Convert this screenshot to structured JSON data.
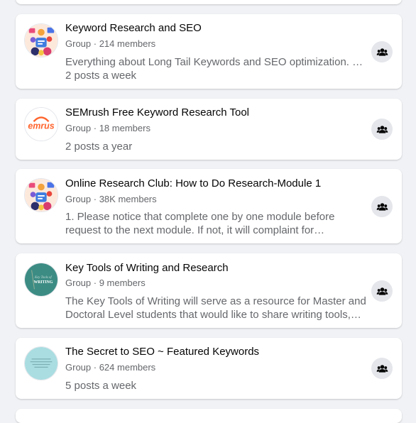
{
  "groups": [
    {
      "name": "Keyword Research and SEO",
      "type": "Group",
      "members": "214 members",
      "desc1": "Everything about Long Tail Keywords and SEO optimization. G…",
      "desc2": "2 posts a week",
      "avatar": "illustration-avatar"
    },
    {
      "name": "SEMrush Free Keyword Research Tool",
      "type": "Group",
      "members": "18 members",
      "desc1": "2 posts a year",
      "avatar": "semrush-logo",
      "avatar_text": "emrus"
    },
    {
      "name": "Online Research Club: How to Do Research-Module 1",
      "type": "Group",
      "members": "38K members",
      "desc1": "1. Please notice that complete one by one module before",
      "desc2": "request to the next module. If not, it will complaint for…",
      "avatar": "illustration-avatar"
    },
    {
      "name": "Key Tools of Writing and Research",
      "type": "Group",
      "members": "9 members",
      "desc1": "The Key Tools of Writing will serve as a resource for Master and",
      "desc2": "Doctoral Level students that would like to share writing tools,…",
      "avatar": "writing-avatar",
      "avatar_text": "WRITING"
    },
    {
      "name": "The Secret to SEO ~ Featured Keywords",
      "type": "Group",
      "members": "624 members",
      "desc1": "5 posts a week",
      "avatar": "light-blue-avatar"
    }
  ],
  "separator": " · ",
  "colors": {
    "page_bg": "#f0f2f5",
    "card_bg": "#ffffff",
    "title": "#050505",
    "secondary": "#65676b",
    "button_bg": "#e4e6eb",
    "semrush_orange": "#ff642d",
    "writing_teal": "#3c8c84",
    "light_blue": "#a9dde1"
  },
  "icons": {
    "group_button": "people-icon"
  }
}
